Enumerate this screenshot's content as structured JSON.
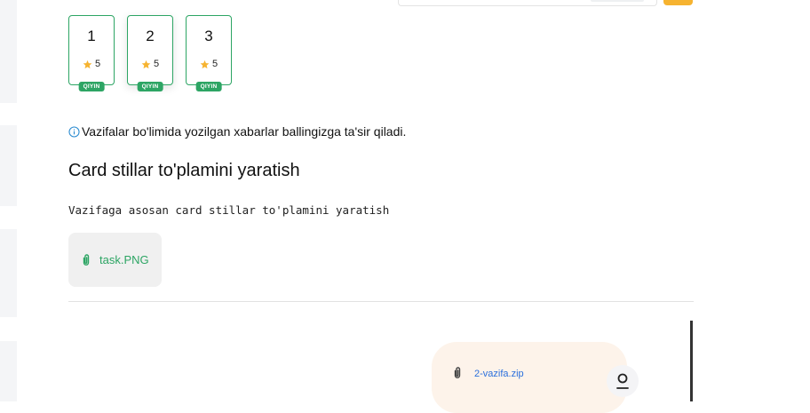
{
  "tasks": [
    {
      "number": "1",
      "score": "5",
      "level": "QIYIN"
    },
    {
      "number": "2",
      "score": "5",
      "level": "QIYIN"
    },
    {
      "number": "3",
      "score": "5",
      "level": "QIYIN"
    }
  ],
  "notice": {
    "text": "Vazifalar bo'limida yozilgan xabarlar ballingizga ta'sir qiladi.",
    "icon": "info-icon"
  },
  "task": {
    "title": "Card stillar to'plamini yaratish",
    "description": "Vazifaga asosan card stillar to'plamini yaratish",
    "attachment": "task.PNG"
  },
  "submission": {
    "file": "2-vazifa.zip"
  },
  "colors": {
    "accent_green": "#2da564",
    "star": "#f6b330",
    "submission_bg": "#fdf3ea",
    "link_blue": "#2a6fdc",
    "top_button": "#f6b330"
  }
}
